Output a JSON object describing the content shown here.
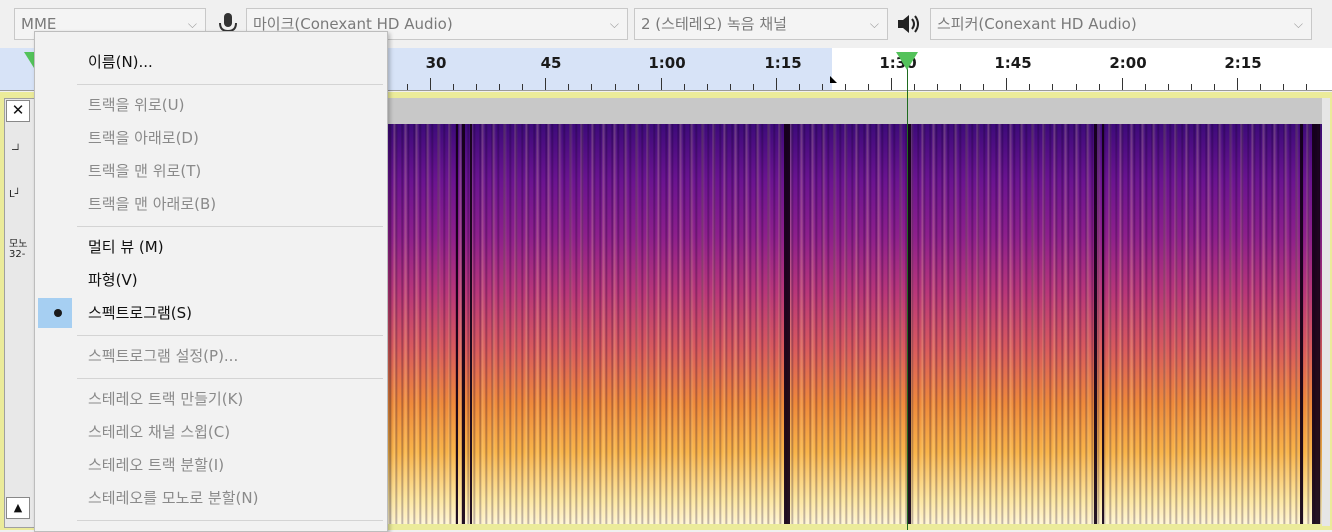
{
  "device_toolbar": {
    "host": "MME",
    "mic_device": "마이크(Conexant HD Audio)",
    "channels": "2 (스테레오) 녹음 채널",
    "speaker_device": "스피커(Conexant HD Audio)",
    "icons": [
      "microphone-icon",
      "speaker-icon",
      "chevron-down-icon"
    ]
  },
  "ruler": {
    "labels": [
      "30",
      "45",
      "1:00",
      "1:15",
      "1:30",
      "1:45",
      "2:00",
      "2:15"
    ]
  },
  "track": {
    "close_label": "✕",
    "collapse_label": "▲",
    "left_text_1": "모노",
    "left_text_2": "32-"
  },
  "context_menu": {
    "items": [
      {
        "label": "이름(N)...",
        "enabled": true
      },
      {
        "label": "트랙을 위로(U)",
        "enabled": false
      },
      {
        "label": "트랙을 아래로(D)",
        "enabled": false
      },
      {
        "label": "트랙을 맨 위로(T)",
        "enabled": false
      },
      {
        "label": "트랙을 맨 아래로(B)",
        "enabled": false
      },
      {
        "label": "멀티 뷰 (M)",
        "enabled": true
      },
      {
        "label": "파형(V)",
        "enabled": true
      },
      {
        "label": "스펙트로그램(S)",
        "enabled": true,
        "checked": true
      },
      {
        "label": "스펙트로그램 설정(P)...",
        "enabled": false
      },
      {
        "label": "스테레오 트랙 만들기(K)",
        "enabled": false
      },
      {
        "label": "스테레오 채널 스윕(C)",
        "enabled": false
      },
      {
        "label": "스테레오 트랙 분할(I)",
        "enabled": false
      },
      {
        "label": "스테레오를 모노로 분할(N)",
        "enabled": false
      }
    ]
  },
  "colors": {
    "selection": "#d7e3f7",
    "accent_check": "#a6cff2",
    "playhead": "#53c25a",
    "track_frame": "#ebeb9a"
  }
}
